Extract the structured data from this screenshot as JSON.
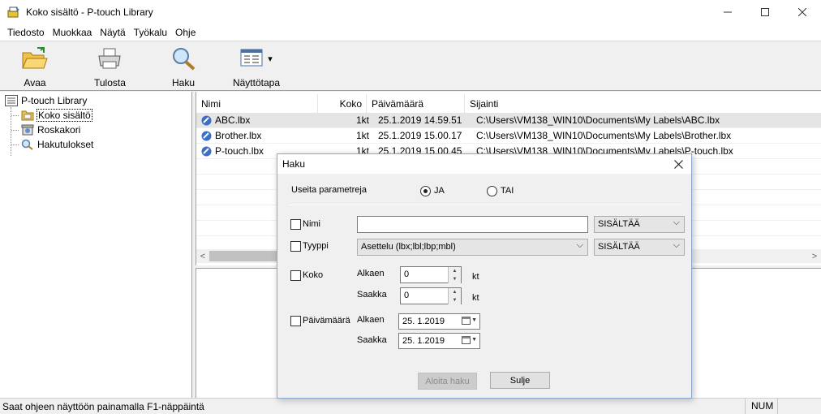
{
  "window": {
    "title": "Koko sisältö - P-touch Library",
    "minimize": "—",
    "maximize": "☐",
    "close": "✕"
  },
  "menu": [
    "Tiedosto",
    "Muokkaa",
    "Näytä",
    "Työkalu",
    "Ohje"
  ],
  "toolbar": {
    "open_label": "Avaa",
    "print_label": "Tulosta",
    "search_label": "Haku",
    "view_label": "Näyttötapa",
    "view_dropdown": "▾"
  },
  "tree": {
    "root": "P-touch Library",
    "items": [
      "Koko sisältö",
      "Roskakori",
      "Hakutulokset"
    ]
  },
  "list": {
    "columns": [
      "Nimi",
      "Koko",
      "Päivämäärä",
      "Sijainti"
    ],
    "rows": [
      {
        "name": "ABC.lbx",
        "size": "1kt",
        "date": "25.1.2019 14.59.51",
        "path": "C:\\Users\\VM138_WIN10\\Documents\\My Labels\\ABC.lbx"
      },
      {
        "name": "Brother.lbx",
        "size": "1kt",
        "date": "25.1.2019 15.00.17",
        "path": "C:\\Users\\VM138_WIN10\\Documents\\My Labels\\Brother.lbx"
      },
      {
        "name": "P-touch.lbx",
        "size": "1kt",
        "date": "25.1.2019 15.00.45",
        "path": "C:\\Users\\VM138_WIN10\\Documents\\My Labels\\P-touch.lbx"
      }
    ],
    "scroll_left": "<",
    "scroll_right": ">"
  },
  "status": {
    "text": "Saat ohjeen näyttöön painamalla F1-näppäintä",
    "num": "NUM"
  },
  "dialog": {
    "title": "Haku",
    "close": "✕",
    "multi_params_label": "Useita parametreja",
    "and_label": "JA",
    "or_label": "TAI",
    "and_selected": true,
    "name_label": "Nimi",
    "name_value": "",
    "name_condition": "SISÄLTÄÄ",
    "type_label": "Tyyppi",
    "type_value": "Asettelu (lbx;lbl;lbp;mbl)",
    "type_condition": "SISÄLTÄÄ",
    "size_label": "Koko",
    "size_from_label": "Alkaen",
    "size_from_value": "0",
    "size_to_label": "Saakka",
    "size_to_value": "0",
    "size_unit": "kt",
    "date_label": "Päivämäärä",
    "date_from_label": "Alkaen",
    "date_from_value": "25.  1.2019",
    "date_to_label": "Saakka",
    "date_to_value": "25.  1.2019",
    "start_button": "Aloita haku",
    "close_button": "Sulje",
    "arrow_down": "⌵",
    "spin_up": "▲",
    "spin_down": "▼"
  }
}
